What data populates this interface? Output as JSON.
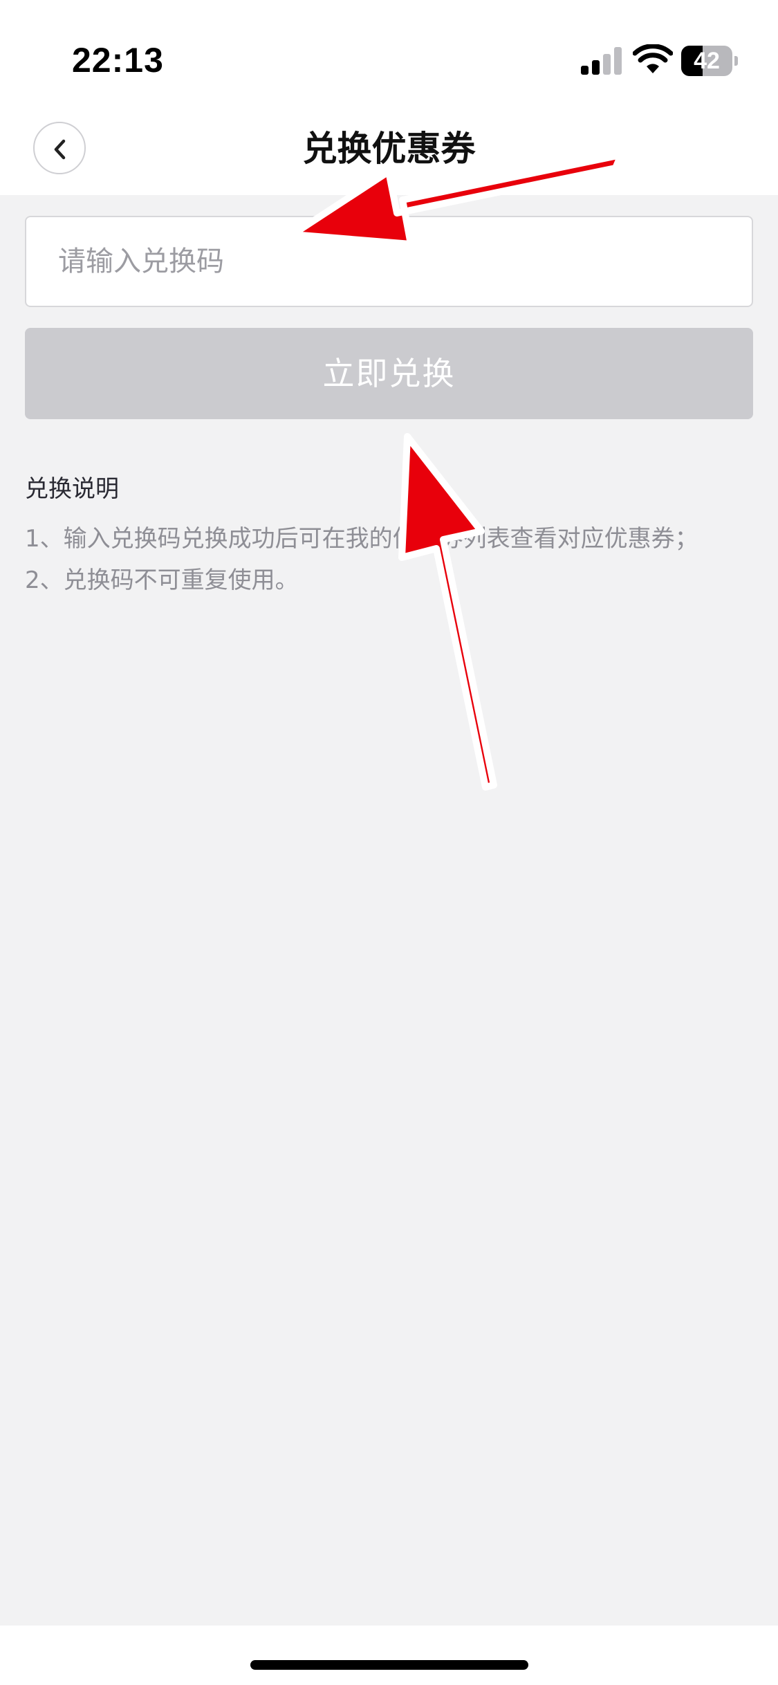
{
  "status_bar": {
    "time": "22:13",
    "battery_level": "42",
    "battery_fraction": 0.42
  },
  "nav": {
    "title": "兑换优惠券",
    "back_icon": "chevron-left-icon"
  },
  "form": {
    "code_placeholder": "请输入兑换码",
    "code_value": "",
    "submit_label": "立即兑换"
  },
  "instructions": {
    "title": "兑换说明",
    "items": [
      "1、输入兑换码兑换成功后可在我的优惠券列表查看对应优惠券；",
      "2、兑换码不可重复使用。"
    ]
  },
  "colors": {
    "page_background": "#f2f2f3",
    "header_background": "#ffffff",
    "button_disabled": "#cbcbcf",
    "annotation_arrow": "#e8000b"
  }
}
